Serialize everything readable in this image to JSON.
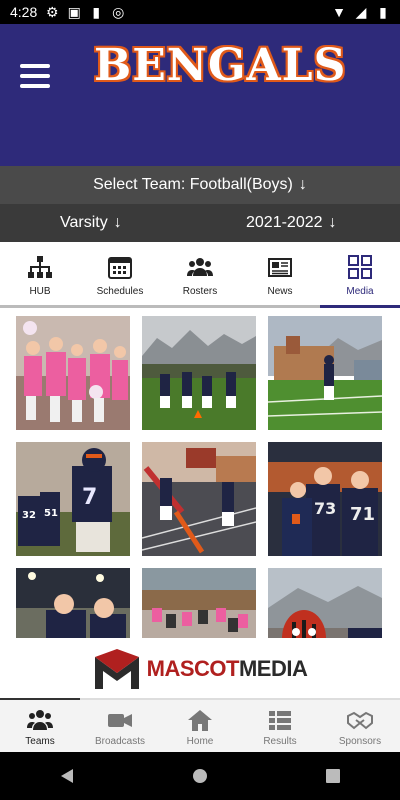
{
  "status": {
    "time": "4:28"
  },
  "header": {
    "title": "BENGALS",
    "colors": {
      "bg": "#2e2a7a",
      "accent": "#e05a1a"
    }
  },
  "team_select": {
    "label": "Select Team: Football(Boys)",
    "arrow": "↓"
  },
  "filters": {
    "level": "Varsity",
    "season": "2021-2022",
    "arrow": "↓"
  },
  "tabs": [
    {
      "label": "HUB",
      "icon": "hub-icon"
    },
    {
      "label": "Schedules",
      "icon": "calendar-icon"
    },
    {
      "label": "Rosters",
      "icon": "people-icon"
    },
    {
      "label": "News",
      "icon": "newspaper-icon"
    },
    {
      "label": "Media",
      "icon": "grid-icon",
      "active": true
    }
  ],
  "photos": [
    {
      "desc": "pink-crowd"
    },
    {
      "desc": "team-run-field"
    },
    {
      "desc": "player-field-school"
    },
    {
      "desc": "player-7"
    },
    {
      "desc": "flags-run"
    },
    {
      "desc": "fans-players"
    },
    {
      "desc": "night-crowd"
    },
    {
      "desc": "stands"
    },
    {
      "desc": "mascot-banner"
    }
  ],
  "sponsor": {
    "brand_red": "MASCOT",
    "brand_dark": "MEDIA"
  },
  "media_progress": 0.2,
  "bottom_nav": [
    {
      "label": "Teams",
      "icon": "teams-icon",
      "active": true
    },
    {
      "label": "Broadcasts",
      "icon": "video-icon"
    },
    {
      "label": "Home",
      "icon": "home-icon"
    },
    {
      "label": "Results",
      "icon": "list-icon"
    },
    {
      "label": "Sponsors",
      "icon": "handshake-icon"
    }
  ]
}
